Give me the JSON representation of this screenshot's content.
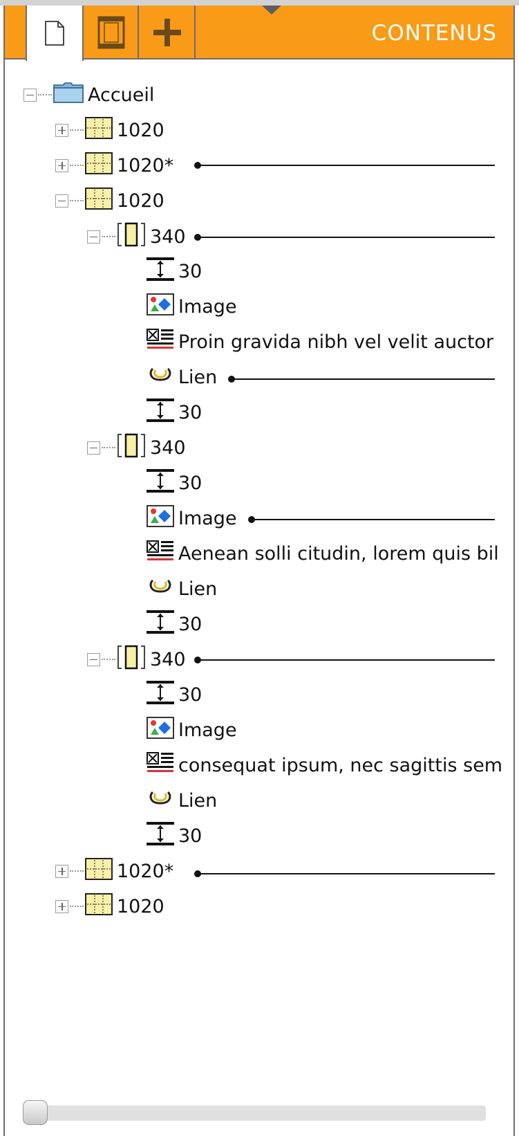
{
  "header": {
    "title": "CONTENUS",
    "tabs": [
      {
        "name": "document",
        "icon": "document-icon",
        "active": true
      },
      {
        "name": "layout",
        "icon": "layout-icon",
        "active": false
      },
      {
        "name": "add",
        "icon": "plus-icon",
        "active": false
      }
    ],
    "accent_color": "#f99b17"
  },
  "tree": {
    "root": {
      "label": "Accueil",
      "icon": "folder-icon",
      "expanded": true
    },
    "nodes": [
      {
        "label": "1020",
        "icon": "grid-block-icon",
        "expanded": false
      },
      {
        "label": "1020*",
        "icon": "grid-block-icon",
        "expanded": false
      },
      {
        "label": "1020",
        "icon": "grid-block-icon",
        "expanded": true
      },
      {
        "label": "340",
        "icon": "column-icon",
        "expanded": true
      },
      {
        "label": "30",
        "icon": "spacer-icon"
      },
      {
        "label": "Image",
        "icon": "image-icon"
      },
      {
        "label": "Proin gravida nibh vel velit auctor",
        "icon": "text-block-icon"
      },
      {
        "label": "Lien",
        "icon": "link-icon"
      },
      {
        "label": "30",
        "icon": "spacer-icon"
      },
      {
        "label": "340",
        "icon": "column-icon",
        "expanded": true
      },
      {
        "label": "30",
        "icon": "spacer-icon"
      },
      {
        "label": "Image",
        "icon": "image-icon"
      },
      {
        "label": "Aenean solli citudin, lorem quis bil",
        "icon": "text-block-icon"
      },
      {
        "label": "Lien",
        "icon": "link-icon"
      },
      {
        "label": "30",
        "icon": "spacer-icon"
      },
      {
        "label": "340",
        "icon": "column-icon",
        "expanded": true
      },
      {
        "label": "30",
        "icon": "spacer-icon"
      },
      {
        "label": "Image",
        "icon": "image-icon"
      },
      {
        "label": "consequat ipsum, nec sagittis sem",
        "icon": "text-block-icon"
      },
      {
        "label": "Lien",
        "icon": "link-icon"
      },
      {
        "label": "30",
        "icon": "spacer-icon"
      },
      {
        "label": "1020*",
        "icon": "grid-block-icon",
        "expanded": false
      },
      {
        "label": "1020",
        "icon": "grid-block-icon",
        "expanded": false
      }
    ]
  },
  "scrollbar": {
    "position": 0
  }
}
